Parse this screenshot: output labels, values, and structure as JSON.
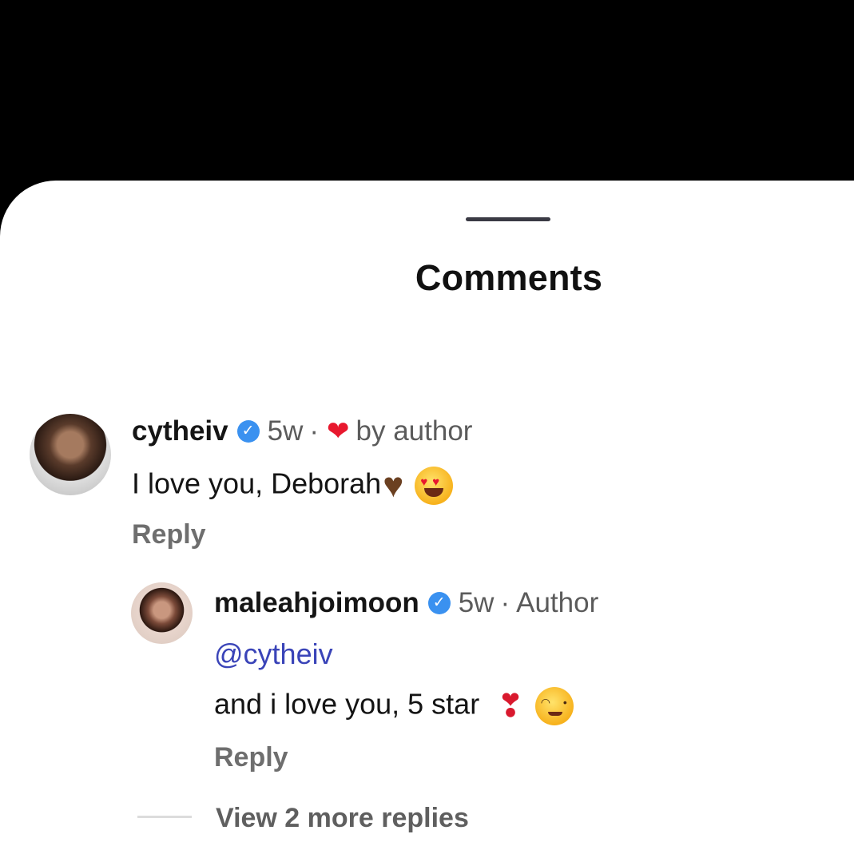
{
  "sheet": {
    "title": "Comments"
  },
  "comment": {
    "username": "cytheiv",
    "time": "5w",
    "separator": "·",
    "liked_label": "by author",
    "text": "I love you, Deborah",
    "reply_label": "Reply"
  },
  "reply": {
    "username": "maleahjoimoon",
    "time": "5w",
    "separator": "·",
    "role": "Author",
    "mention": "@cytheiv",
    "text": "and i love you, 5 star",
    "reply_label": "Reply"
  },
  "view_more": "View 2 more replies",
  "icons": {
    "verified": "verified-badge-icon",
    "liked": "red-heart-icon",
    "brown_heart": "brown-heart-emoji",
    "heart_eyes": "heart-eyes-emoji",
    "exclamation": "red-exclamation-emoji",
    "wink": "winking-face-emoji"
  },
  "colors": {
    "verified": "#3a91f0",
    "mention": "#3a44b8",
    "heart": "#e8182e"
  }
}
